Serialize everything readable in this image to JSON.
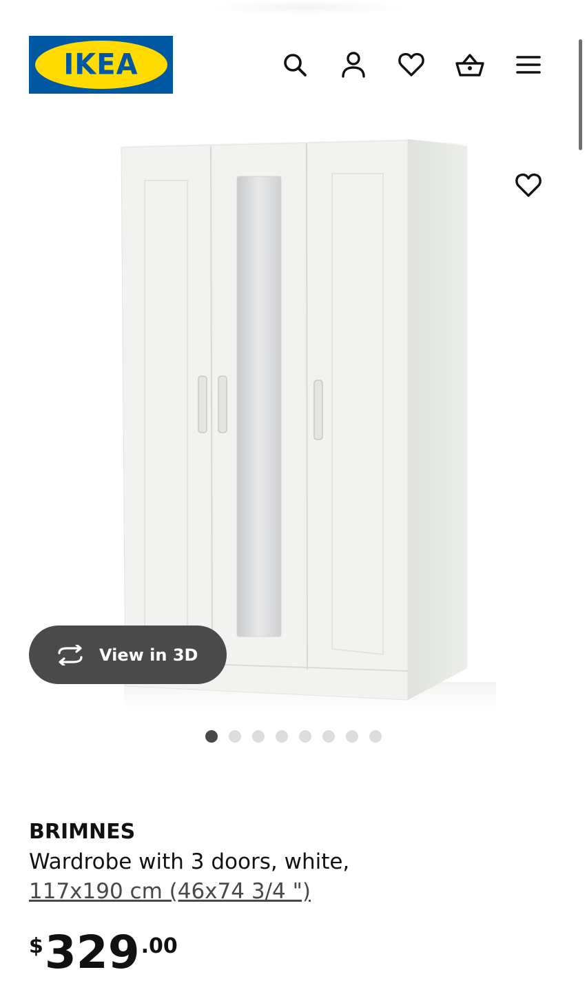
{
  "brand": {
    "logo_text": "IKEA",
    "colors": {
      "blue": "#0058a3",
      "yellow": "#ffdb00"
    }
  },
  "header": {
    "icons": [
      "search-icon",
      "account-icon",
      "heart-icon",
      "cart-icon",
      "menu-icon"
    ]
  },
  "gallery": {
    "view_3d_label": "View in 3D",
    "dot_count": 8,
    "active_dot": 1
  },
  "product": {
    "name": "BRIMNES",
    "description": "Wardrobe with 3 doors, white,",
    "size": "117x190 cm (46x74 3/4 \")",
    "price": {
      "currency": "$",
      "integer": "329",
      "decimal": ".00"
    }
  }
}
